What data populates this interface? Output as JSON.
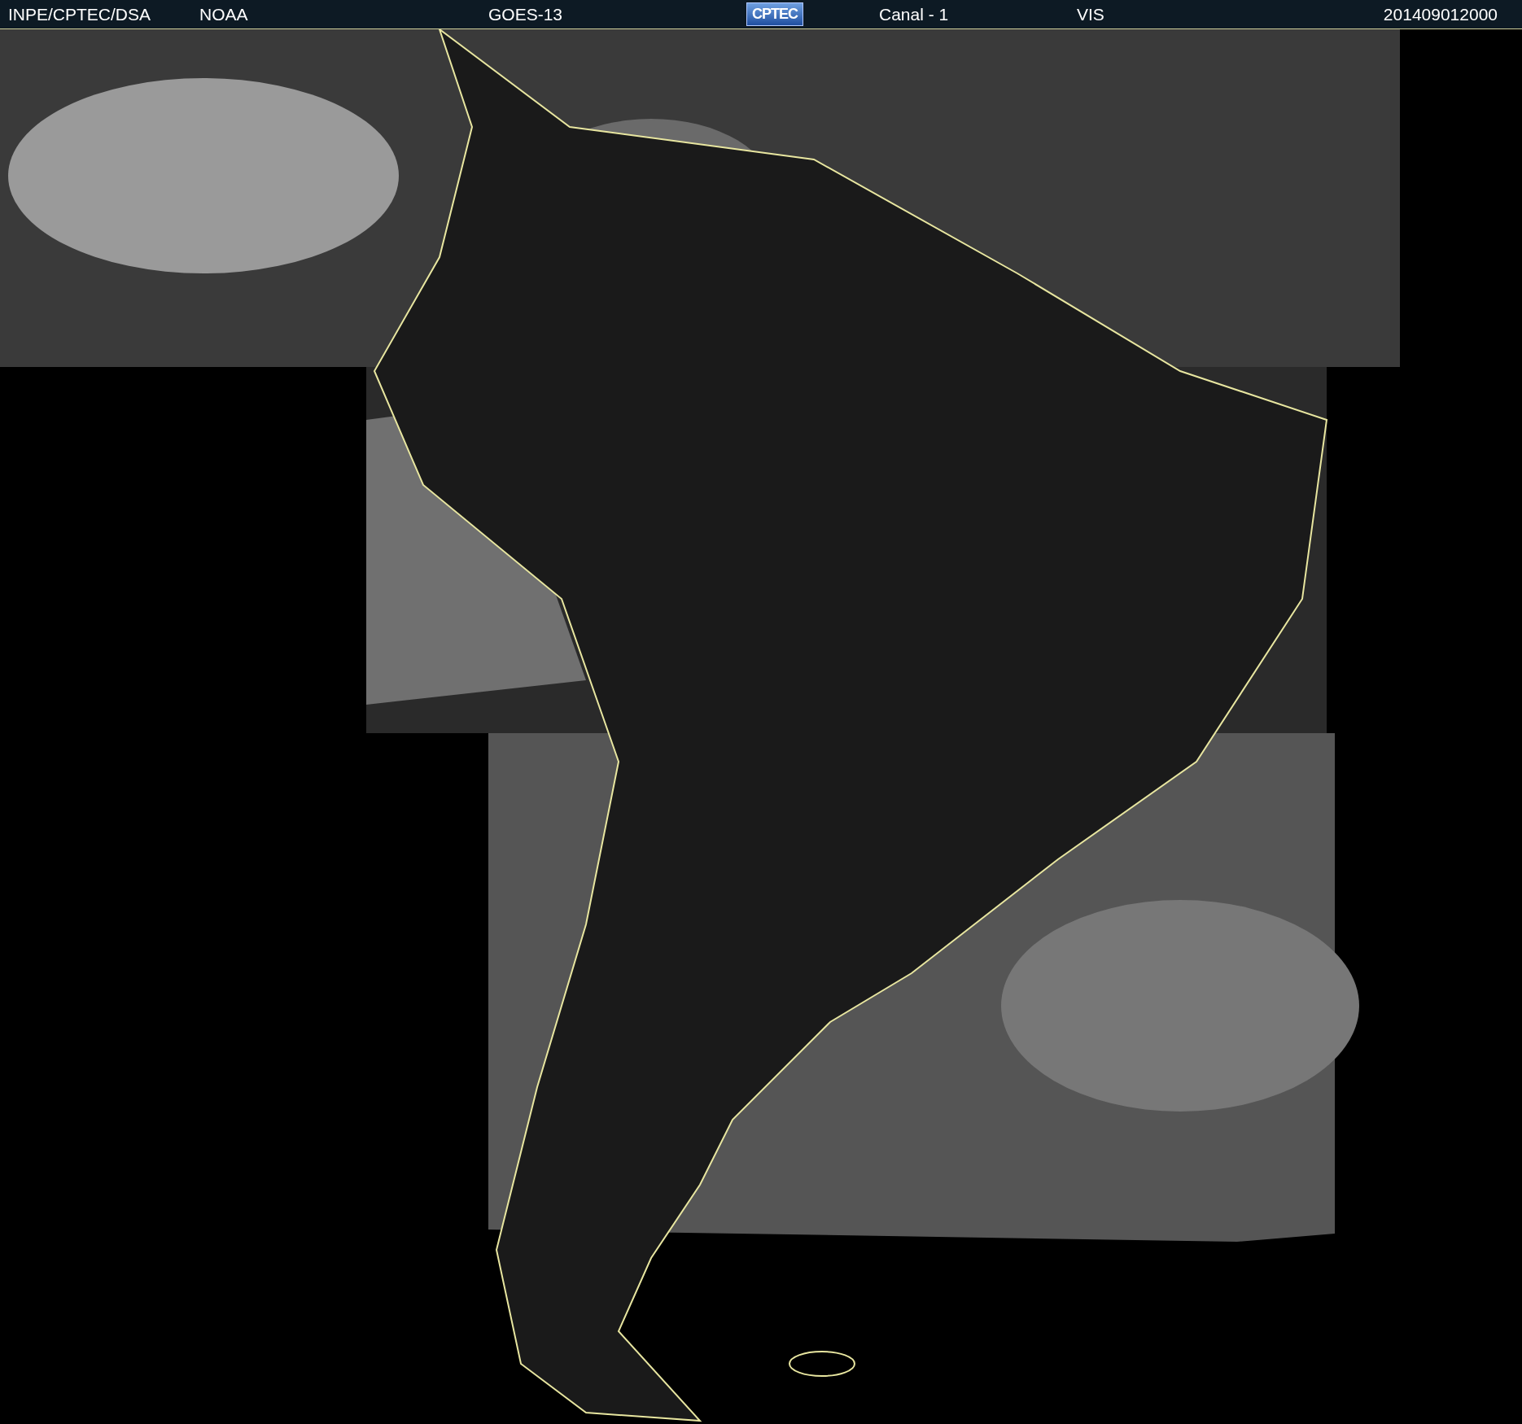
{
  "header": {
    "items": [
      {
        "kind": "text",
        "text": "INPE/CPTEC/DSA"
      },
      {
        "kind": "text",
        "text": "NOAA"
      },
      {
        "kind": "text",
        "text": "GOES-13"
      },
      {
        "kind": "logo",
        "text": "CPTEC"
      },
      {
        "kind": "text",
        "text": "Canal - 1"
      },
      {
        "kind": "text",
        "text": "VIS"
      },
      {
        "kind": "text",
        "text": "201409012000"
      }
    ]
  }
}
